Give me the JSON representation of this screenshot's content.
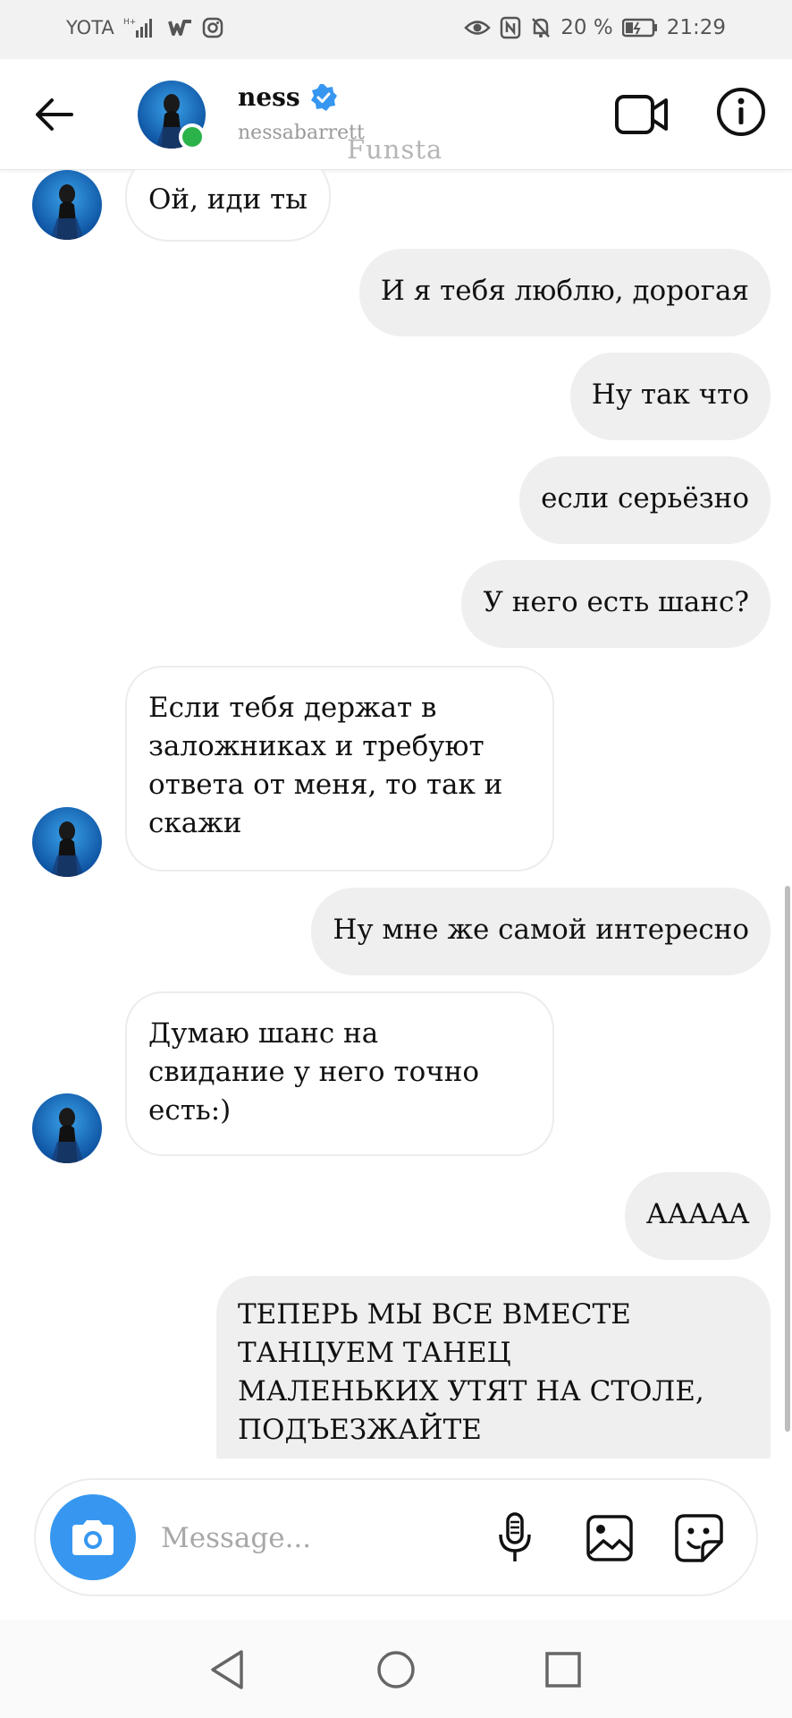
{
  "status_bar": {
    "carrier": "YOTA",
    "battery": "20 %",
    "time": "21:29",
    "icons_left": [
      "signal-icon",
      "wattpad-icon",
      "instagram-icon"
    ],
    "icons_right": [
      "eye-icon",
      "nfc-icon",
      "mute-icon",
      "battery-icon"
    ]
  },
  "header": {
    "name": "ness",
    "username": "nessabarrett",
    "watermark": "Funsta",
    "online": true,
    "verified_color": "#3797f0",
    "online_color": "#2bb34a"
  },
  "messages": [
    {
      "from": "them",
      "text": "Ой, иди ты",
      "avatar": true
    },
    {
      "from": "me",
      "text": "И я тебя люблю, дорогая"
    },
    {
      "from": "me",
      "text": "Ну так что"
    },
    {
      "from": "me",
      "text": "если серьёзно"
    },
    {
      "from": "me",
      "text": "У него есть шанс?"
    },
    {
      "from": "them",
      "lines": [
        "Если тебя держат в",
        "заложниках и требуют",
        "ответа от меня, то так и",
        "скажи"
      ],
      "avatar": true
    },
    {
      "from": "me",
      "text": "Ну мне же самой интересно"
    },
    {
      "from": "them",
      "lines": [
        "Думаю шанс на",
        "свидание у него точно",
        "есть:)"
      ],
      "avatar": true
    },
    {
      "from": "me",
      "text": "АААAA"
    },
    {
      "from": "me",
      "lines": [
        "ТЕПЕРЬ МЫ ВСЕ ВМЕСТЕ",
        "ТАНЦУЕМ ТАНЕЦ",
        "МАЛЕНЬКИХ УТЯТ НА СТОЛЕ,",
        "ПОДЪЕЗЖАЙТЕ"
      ]
    }
  ],
  "composer": {
    "placeholder": "Message...",
    "accent": "#3797f0"
  },
  "navbar": {
    "buttons": [
      "back-nav-icon",
      "home-nav-icon",
      "recents-nav-icon"
    ]
  }
}
